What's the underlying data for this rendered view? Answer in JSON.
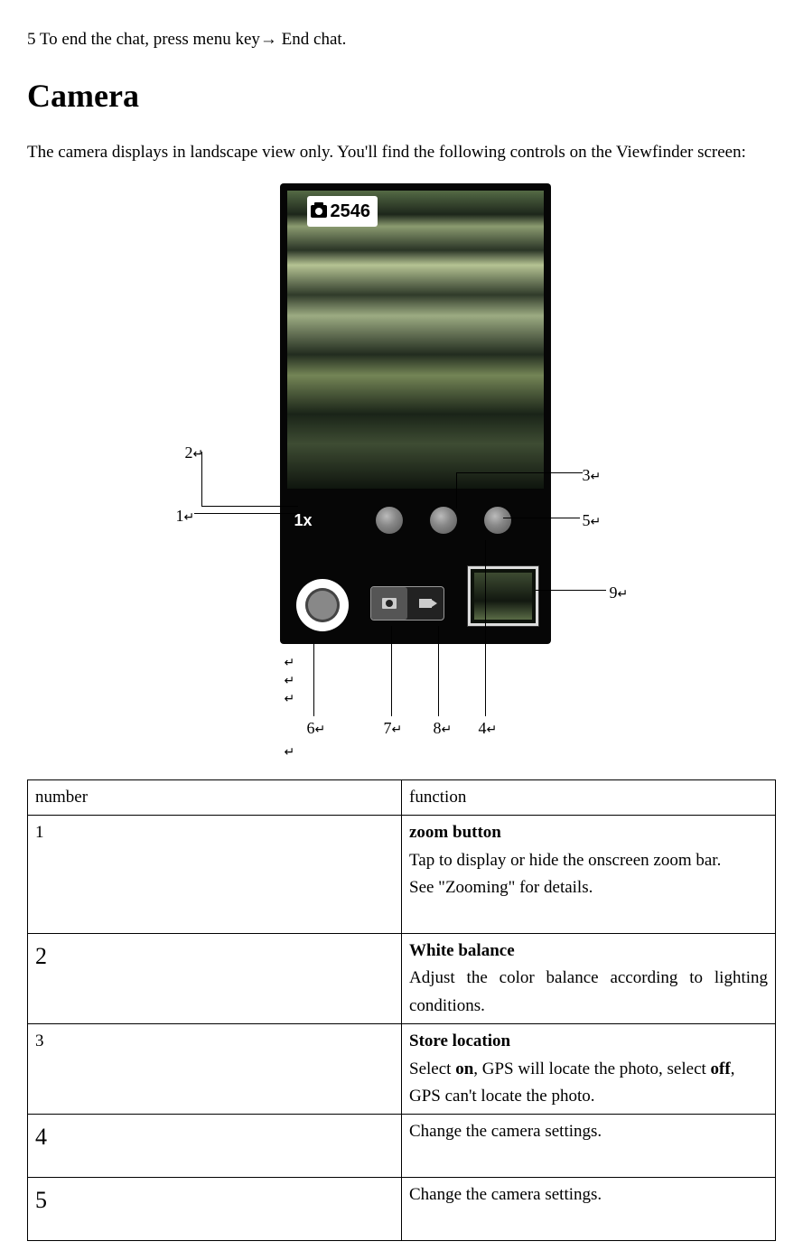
{
  "intro_line": "5 To end the chat, press menu key→  End chat.",
  "heading": "Camera",
  "description": "The camera displays in landscape view only. You'll find the following controls on the Viewfinder screen:",
  "overlay": {
    "counter": "2546",
    "zoom": "1x"
  },
  "callouts": {
    "c1": "1",
    "c2": "2",
    "c3": "3",
    "c4": "4",
    "c5": "5",
    "c6": "6",
    "c7": "7",
    "c8": "8",
    "c9": "9"
  },
  "table": {
    "header_num": "number",
    "header_func": "function",
    "rows": {
      "r1_num": "1",
      "r1_title": "zoom button",
      "r1_l1": "Tap to display or hide the onscreen zoom bar.",
      "r1_l2": "See \"Zooming\" for details.",
      "r2_num": "2",
      "r2_title": "White balance",
      "r2_desc": "Adjust the color balance according to lighting conditions.",
      "r3_num": "3",
      "r3_title": "Store location",
      "r3_p1": "Select ",
      "r3_on": "on",
      "r3_p2": ", GPS will locate the photo, select ",
      "r3_off": "off",
      "r3_p3": ", GPS can't locate the photo.",
      "r4_num": "4",
      "r4_desc": "Change the camera settings.",
      "r5_num": "5",
      "r5_desc": "Change the camera settings."
    }
  }
}
